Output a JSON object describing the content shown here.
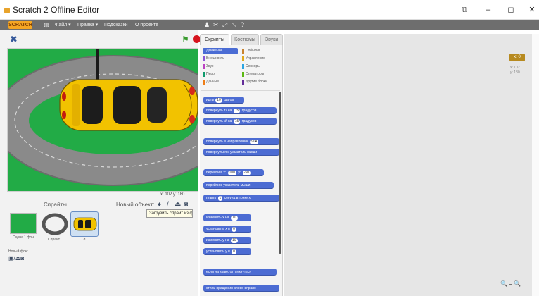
{
  "window": {
    "title": "Scratch 2 Offline Editor",
    "controls": [
      "⧉",
      "–",
      "◻",
      "✕"
    ]
  },
  "menubar": {
    "logo": "SCRATCH",
    "items": [
      "Файл ▾",
      "Правка ▾",
      "Подсказки",
      "О проекте"
    ],
    "tool_icons": [
      "duplicate-icon",
      "delete-icon",
      "grow-icon",
      "shrink-icon",
      "help-icon"
    ]
  },
  "stage": {
    "readout": "x: 102  y: 180",
    "colors": {
      "grass": "#22ab46",
      "track": "#8a8a8a",
      "car": "#f2c200"
    }
  },
  "sprites_panel": {
    "label": "Спрайты",
    "new_sprite_label": "Новый объект:",
    "tooltip": "Загрузить спрайт из файла",
    "stage_thumb_label": "Сцена\n1 фон",
    "sprite_labels": [
      "Спрайт1",
      "d"
    ],
    "new_backdrop_label": "Новый фон:"
  },
  "tabs": [
    "Скрипты",
    "Костюмы",
    "Звуки"
  ],
  "categories": {
    "left": [
      {
        "label": "Движение",
        "color": "#4a6cd4"
      },
      {
        "label": "Внешность",
        "color": "#8a55d7"
      },
      {
        "label": "Звук",
        "color": "#bb42c3"
      },
      {
        "label": "Перо",
        "color": "#0e9a6c"
      },
      {
        "label": "Данные",
        "color": "#ee7d16"
      }
    ],
    "right": [
      {
        "label": "События",
        "color": "#c88330"
      },
      {
        "label": "Управление",
        "color": "#e1a91a"
      },
      {
        "label": "Сенсоры",
        "color": "#2ca5e2"
      },
      {
        "label": "Операторы",
        "color": "#5cb712"
      },
      {
        "label": "Другие блоки",
        "color": "#632d99"
      }
    ]
  },
  "blocks": [
    {
      "pre": "идти",
      "slot": "10",
      "post": "шагов"
    },
    {
      "pre": "повернуть ↻ на",
      "slot": "15",
      "post": "градусов"
    },
    {
      "pre": "повернуть ↺ на",
      "slot": "15",
      "post": "градусов"
    },
    {
      "pre": "повернуть в направлении",
      "slot": "90▾",
      "post": ""
    },
    {
      "pre": "повернуться к",
      "slot": "",
      "post": "указатель мыши"
    },
    {
      "pre": "перейти в x:",
      "slot": "100",
      "post": "y:",
      "slot2": "-50"
    },
    {
      "pre": "перейти в",
      "slot": "",
      "post": "указатель мыши"
    },
    {
      "pre": "плыть",
      "slot": "1",
      "post": "секунд в точку x:"
    },
    {
      "pre": "изменить x на",
      "slot": "10",
      "post": ""
    },
    {
      "pre": "установить x в",
      "slot": "0",
      "post": ""
    },
    {
      "pre": "изменить y на",
      "slot": "10",
      "post": ""
    },
    {
      "pre": "установить y в",
      "slot": "0",
      "post": ""
    },
    {
      "pre": "если на краю, оттолкнуться",
      "slot": "",
      "post": ""
    },
    {
      "pre": "стиль вращения",
      "slot": "",
      "post": "влево-вправо"
    }
  ],
  "scripts_area": {
    "xy_badge": "x: 0",
    "xy_lines": [
      "x: 102",
      "y: 180"
    ],
    "zoom": [
      "🔍",
      "=",
      "🔍"
    ]
  }
}
